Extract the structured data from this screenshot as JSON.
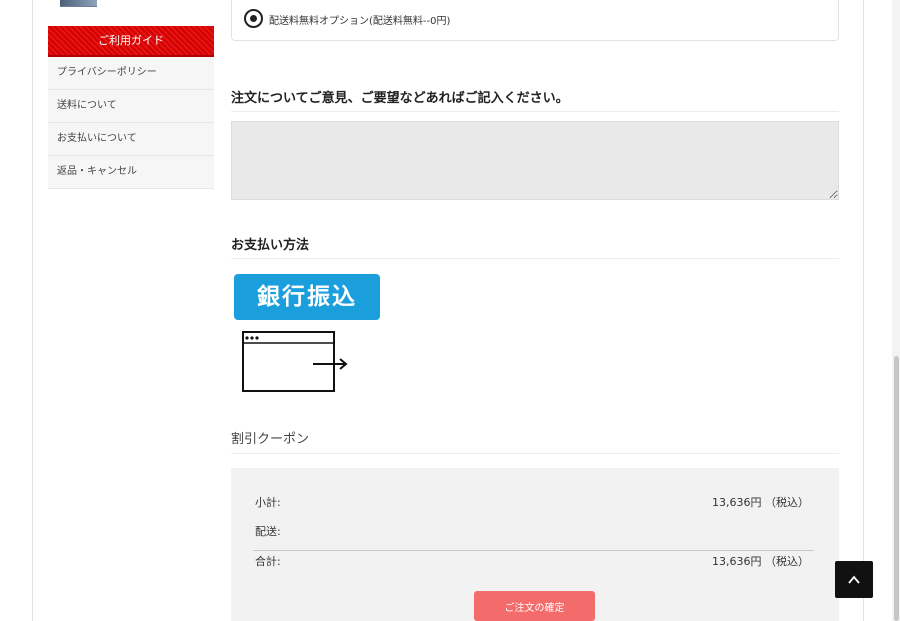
{
  "sidebar": {
    "guide_header": "ご利用ガイド",
    "items": [
      {
        "label": "プライバシーポリシー"
      },
      {
        "label": "送料について"
      },
      {
        "label": "お支払いについて"
      },
      {
        "label": "返品・キャンセル"
      }
    ]
  },
  "shipping": {
    "option_label": "配送料無料オプション(配送料無料--0円)",
    "selected": true
  },
  "comments": {
    "title": "注文についてご意見、ご要望などあればご記入ください。",
    "value": ""
  },
  "payment": {
    "title": "お支払い方法",
    "bank_transfer_label": "銀行振込",
    "window_icon": "browser-window-arrow-icon"
  },
  "coupon": {
    "title": "割引クーポン"
  },
  "summary": {
    "subtotal_label": "小計:",
    "subtotal_value": "13,636円 （税込）",
    "shipping_label": "配送:",
    "total_label": "合計:",
    "total_value": "13,636円 （税込）",
    "confirm_label": "ご注文の確定"
  },
  "colors": {
    "guide_header": "#d40000",
    "bank_badge": "#1a9fdc",
    "confirm_button": "#f36b6b",
    "back_to_top": "#111111"
  },
  "icons": {
    "back_to_top": "chevron-up-icon",
    "radio": "radio-selected-icon"
  }
}
